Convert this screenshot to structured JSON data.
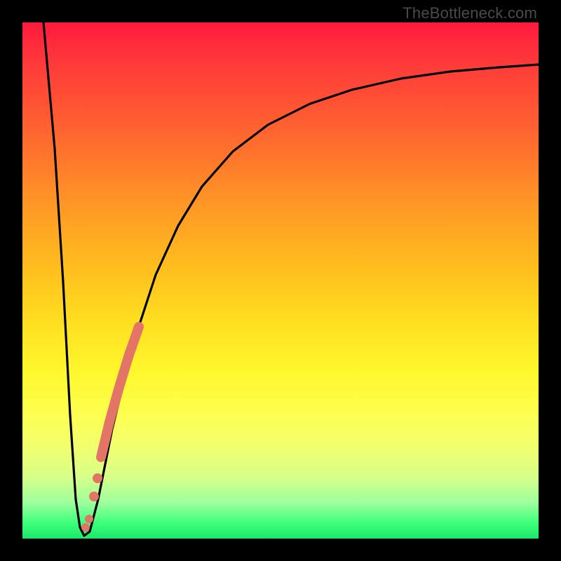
{
  "watermark": "TheBottleneck.com",
  "colors": {
    "frame": "#000000",
    "curve": "#000000",
    "marker": "#e27566"
  },
  "chart_data": {
    "type": "line",
    "title": "",
    "xlabel": "",
    "ylabel": "",
    "xlim": [
      0,
      100
    ],
    "ylim": [
      0,
      100
    ],
    "grid": false,
    "legend": false,
    "series": [
      {
        "name": "bottleneck-curve",
        "x": [
          4,
          6,
          8,
          9.5,
          11,
          13,
          15,
          18,
          22,
          26,
          30,
          34,
          38,
          44,
          50,
          58,
          66,
          74,
          82,
          90,
          100
        ],
        "y": [
          100,
          70,
          35,
          10,
          1,
          2,
          10,
          22,
          38,
          51,
          60,
          67,
          72,
          77,
          81,
          84,
          86.5,
          88.2,
          89.5,
          90.4,
          91.2
        ]
      }
    ],
    "segment": {
      "name": "highlighted-range",
      "x_start": 14,
      "x_end": 22,
      "y_start": 6,
      "y_end": 40
    },
    "dots": [
      {
        "x": 12.5,
        "y": 2
      },
      {
        "x": 13.2,
        "y": 3.5
      },
      {
        "x": 14.2,
        "y": 8
      },
      {
        "x": 15.0,
        "y": 11.5
      }
    ]
  }
}
